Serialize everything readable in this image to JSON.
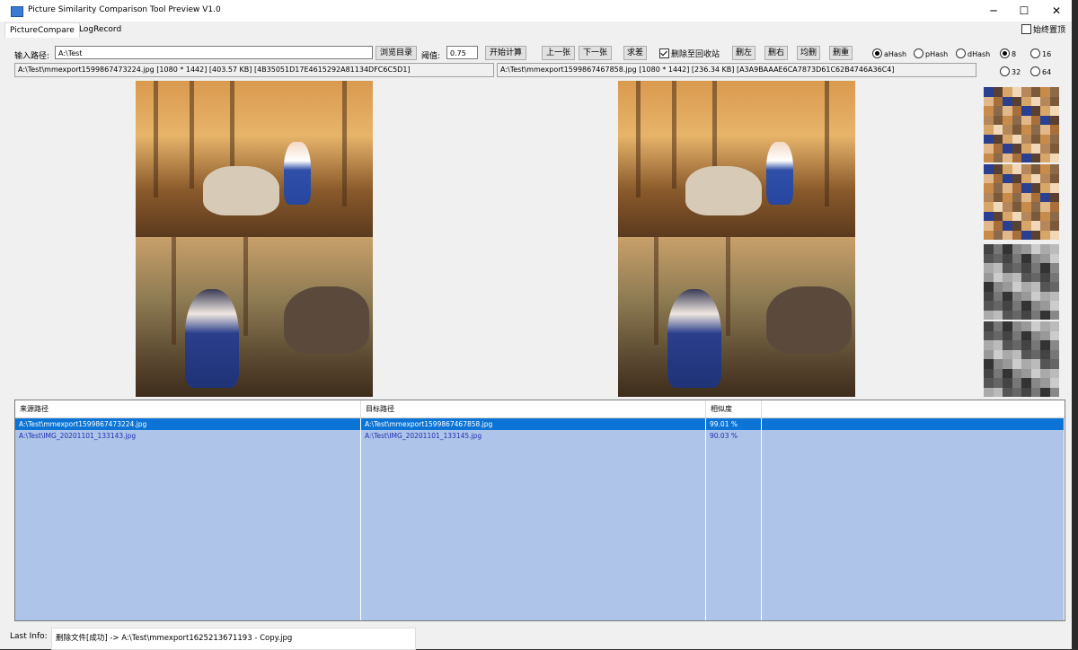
{
  "window": {
    "title": "Picture Similarity Comparison Tool Preview V1.0",
    "minimize": "─",
    "maximize": "☐",
    "close": "✕"
  },
  "tabs": [
    {
      "label": "PictureCompare"
    },
    {
      "label": "LogRecord"
    }
  ],
  "always_on_top": {
    "label": "始终置顶",
    "checked": false
  },
  "toolbar": {
    "path_label": "输入路径:",
    "path_value": "A:\\Test",
    "browse": "浏览目录",
    "threshold_label": "阈值:",
    "threshold_value": "0.75",
    "start": "开始计算",
    "prev": "上一张",
    "next": "下一张",
    "diff": "求差",
    "recycle_label": "删除至回收站",
    "recycle_checked": true,
    "del_left": "删左",
    "del_right": "删右",
    "del_both": "均删",
    "del_dup": "删重"
  },
  "hash_options": [
    {
      "label": "aHash",
      "selected": true
    },
    {
      "label": "pHash",
      "selected": false
    },
    {
      "label": "dHash",
      "selected": false
    }
  ],
  "size_options": [
    {
      "label": "8",
      "selected": true
    },
    {
      "label": "16",
      "selected": false
    },
    {
      "label": "32",
      "selected": false
    },
    {
      "label": "64",
      "selected": false
    }
  ],
  "left_info": "A:\\Test\\mmexport1599867473224.jpg [1080 * 1442] [403.57 KB] [4B35051D17E4615292A81134DFC6C5D1]",
  "right_info": "A:\\Test\\mmexport1599867467858.jpg [1080 * 1442] [236.34 KB] [A3A9BAAAE6CA7873D61C62B4746A36C4]",
  "grid": {
    "headers": [
      "来源路径",
      "目标路径",
      "相似度"
    ],
    "rows": [
      {
        "source": "A:\\Test\\mmexport1599867473224.jpg",
        "target": "A:\\Test\\mmexport1599867467858.jpg",
        "similarity": "99.01 %",
        "selected": true
      },
      {
        "source": "A:\\Test\\IMG_20201101_133143.jpg",
        "target": "A:\\Test\\IMG_20201101_133145.jpg",
        "similarity": "90.03 %",
        "selected": false
      }
    ]
  },
  "status": {
    "label": "Last Info:",
    "value": "删除文件[成功] -> A:\\Test\\mmexport1625213671193 - Copy.jpg"
  },
  "colors": {
    "selection": "#0b74d6",
    "row_fill": "#aec4e8",
    "row_text": "#1f2fb5"
  }
}
